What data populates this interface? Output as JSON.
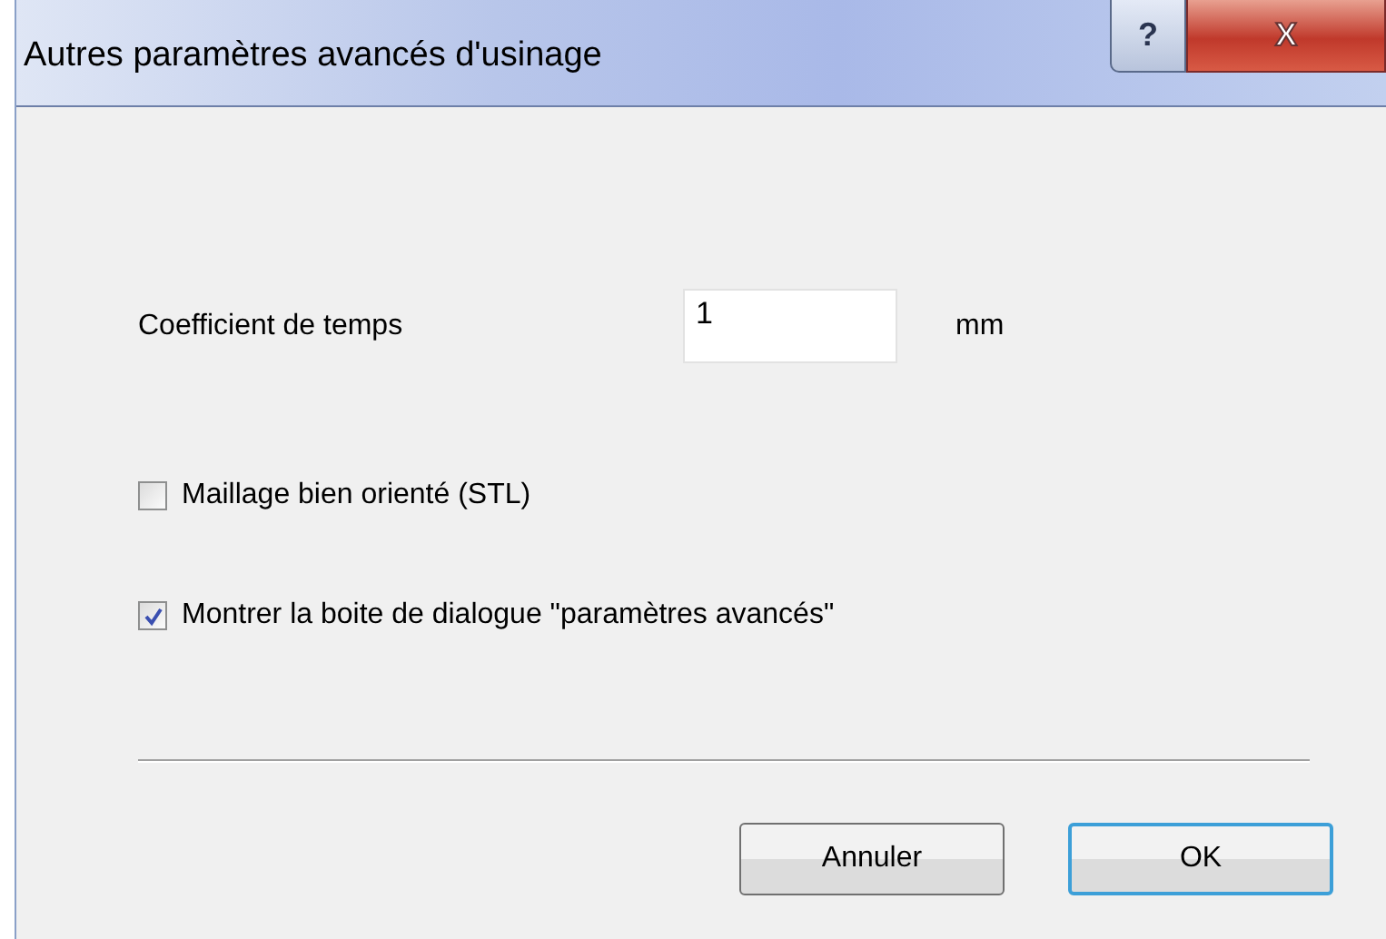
{
  "window": {
    "title": "Autres paramètres avancés d'usinage",
    "help_button": "?",
    "close_button": "X"
  },
  "field": {
    "label": "Coefficient de temps",
    "value": "1",
    "unit": "mm"
  },
  "checkboxes": [
    {
      "label": "Maillage bien orienté (STL)",
      "checked": false
    },
    {
      "label": "Montrer la boite de dialogue \"paramètres avancés\"",
      "checked": true
    }
  ],
  "buttons": [
    {
      "label": "Annuler",
      "default": false
    },
    {
      "label": "OK",
      "default": true
    }
  ]
}
